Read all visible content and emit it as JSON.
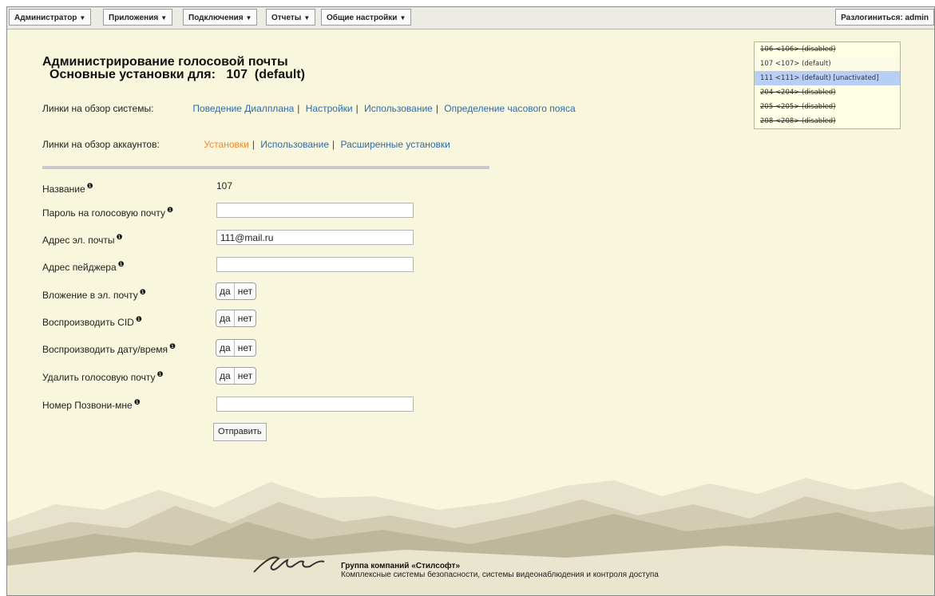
{
  "menu": {
    "items": [
      {
        "label": "Администратор"
      },
      {
        "label": "Приложения"
      },
      {
        "label": "Подключения"
      },
      {
        "label": "Отчеты"
      },
      {
        "label": "Общие настройки"
      }
    ],
    "logout_label": "Разлогиниться: admin"
  },
  "extensions": [
    {
      "label": "106 <106>  (disabled)",
      "state": "disabled"
    },
    {
      "label": "107 <107>  (default)",
      "state": "default"
    },
    {
      "label": "111 <111>  (default) [unactivated]",
      "state": "selected"
    },
    {
      "label": "204 <204>  (disabled)",
      "state": "disabled"
    },
    {
      "label": "205 <205>  (disabled)",
      "state": "disabled"
    },
    {
      "label": "208 <208>  (disabled)",
      "state": "disabled"
    }
  ],
  "page": {
    "title": "Администрирование голосовой почты",
    "subtitle_prefix": "Основные установки для:",
    "subtitle_account": "107  (default)"
  },
  "system_links": {
    "label": "Линки на обзор системы:",
    "items": [
      "Поведение Диалплана",
      "Настройки",
      "Использование",
      "Определение часового пояса"
    ]
  },
  "account_links": {
    "label": "Линки на обзор аккаунтов:",
    "items": [
      "Установки",
      "Использование",
      "Расширенные установки"
    ],
    "active": "Установки"
  },
  "form": {
    "name_label": "Название",
    "name_value": "107",
    "password_label": "Пароль на голосовую почту",
    "password_value": "",
    "email_label": "Адрес эл. почты",
    "email_value": "111@mail.ru",
    "pager_label": "Адрес пейджера",
    "pager_value": "",
    "attach_label": "Вложение в эл. почту",
    "saycid_label": "Воспроизводить CID",
    "envelope_label": "Воспроизводить дату/время",
    "delete_label": "Удалить голосовую почту",
    "callme_label": "Номер Позвони-мне",
    "callme_value": "",
    "yes_label": "да",
    "no_label": "нет",
    "submit_label": "Отправить",
    "help_glyph": "❶"
  },
  "footer": {
    "company": "Группа компаний «Стилсофт»",
    "description": "Комплексные системы безопасности, системы видеонаблюдения и контроля доступа"
  },
  "colors": {
    "background": "#f8f6dc",
    "link": "#2f6aa8",
    "active_link": "#f08a2d",
    "selected_row": "#b8cff5"
  }
}
